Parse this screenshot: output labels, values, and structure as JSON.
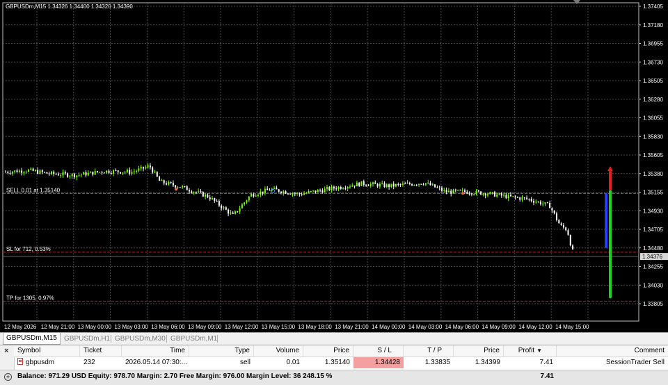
{
  "chart": {
    "header": "GBPUSDm,M15  1.34326 1.34400 1.34320 1.34390",
    "price_axis": [
      "1.37405",
      "1.37180",
      "1.36955",
      "1.36730",
      "1.36505",
      "1.36280",
      "1.36055",
      "1.35830",
      "1.35605",
      "1.35380",
      "1.35155",
      "1.34930",
      "1.34705",
      "1.34480",
      "1.34255",
      "1.34030",
      "1.33805"
    ],
    "current_price": "1.34376",
    "time_axis": [
      "12 May 2026",
      "12 May 21:00",
      "13 May 00:00",
      "13 May 03:00",
      "13 May 06:00",
      "13 May 09:00",
      "13 May 12:00",
      "13 May 15:00",
      "13 May 18:00",
      "13 May 21:00",
      "14 May 00:00",
      "14 May 03:00",
      "14 May 06:00",
      "14 May 09:00",
      "14 May 12:00",
      "14 May 15:00"
    ],
    "lines": {
      "sell": "SELL 0.01 at 1.35140",
      "sl": "SL for 712, 0.53%",
      "tp": "TP for 1305, 0.97%"
    },
    "colors": {
      "background": "#000000",
      "bull": "#7cfc00",
      "bear": "#ffffff",
      "grid": "#4a4a4a",
      "sl_line": "#b22222",
      "sell_line": "#808080",
      "bar_red": "#e02020",
      "bar_blue": "#2040ff",
      "bar_green": "#20d020"
    }
  },
  "tabs": [
    "GBPUSDm,M15",
    "GBPUSDm,H1",
    "GBPUSDm,M30",
    "GBPUSDm,M1"
  ],
  "terminal": {
    "close": "×",
    "headers": {
      "symbol": "Symbol",
      "ticket": "Ticket",
      "time": "Time",
      "type": "Type",
      "volume": "Volume",
      "price": "Price",
      "sl": "S / L",
      "tp": "T / P",
      "cur_price": "Price",
      "profit": "Profit",
      "comment": "Comment"
    },
    "order": {
      "symbol": "gbpusdm",
      "ticket": "232",
      "time": "2026.05.14 07:30:...",
      "type": "sell",
      "volume": "0.01",
      "price": "1.35140",
      "sl": "1.34428",
      "tp": "1.33835",
      "cur_price": "1.34399",
      "profit": "7.41",
      "comment": "SessionTrader Sell"
    },
    "balance": "Balance: 971.29 USD  Equity: 978.70  Margin: 2.70  Free Margin: 976.00  Margin Level: 36 248.15 %",
    "balance_profit": "7.41"
  }
}
